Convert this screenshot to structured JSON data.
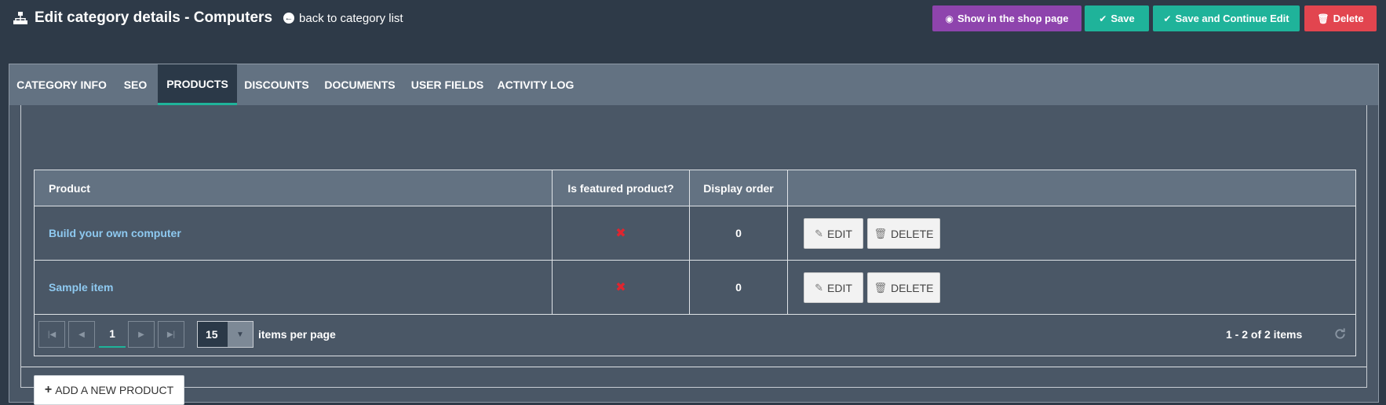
{
  "header": {
    "title": "Edit category details - Computers",
    "back_link": "back to category list",
    "buttons": {
      "show_in_shop": "Show in the shop page",
      "save": "Save",
      "save_continue": "Save and Continue Edit",
      "delete": "Delete"
    }
  },
  "tabs": [
    {
      "label": "CATEGORY INFO"
    },
    {
      "label": "SEO"
    },
    {
      "label": "PRODUCTS",
      "active": true
    },
    {
      "label": "DISCOUNTS"
    },
    {
      "label": "DOCUMENTS"
    },
    {
      "label": "USER FIELDS"
    },
    {
      "label": "ACTIVITY LOG"
    }
  ],
  "grid": {
    "columns": [
      "Product",
      "Is featured product?",
      "Display order"
    ],
    "rows": [
      {
        "product": "Build your own computer",
        "featured": "✖",
        "display_order": "0",
        "edit": "EDIT",
        "delete": "DELETE"
      },
      {
        "product": "Sample item",
        "featured": "✖",
        "display_order": "0",
        "edit": "EDIT",
        "delete": "DELETE"
      }
    ],
    "pager": {
      "current_page": "1",
      "page_size": "15",
      "per_page_label": "items per page",
      "info": "1 - 2 of 2 items"
    }
  },
  "add_button": "ADD A NEW PRODUCT",
  "colors": {
    "background": "#2e3a48",
    "purple": "#8e44ad",
    "green": "#1fb39a",
    "red": "#e2454f",
    "link": "#8ec9f0"
  }
}
